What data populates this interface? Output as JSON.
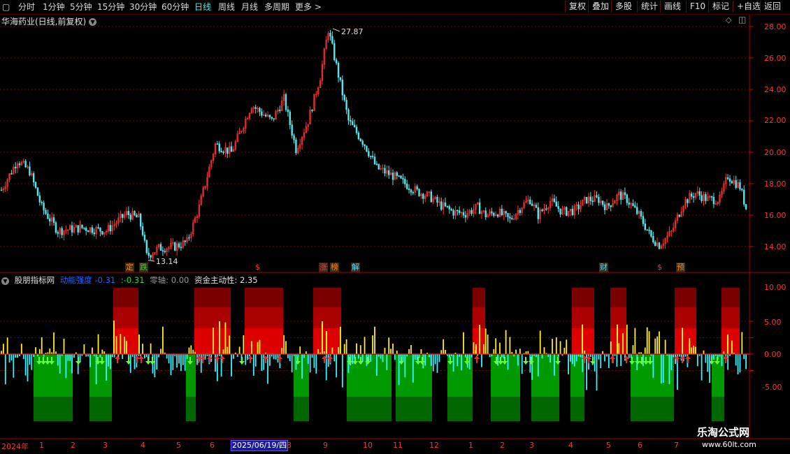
{
  "toolbar": {
    "periods": [
      "分时",
      "1分钟",
      "5分钟",
      "15分钟",
      "30分钟",
      "60分钟",
      "日线",
      "周线",
      "月线",
      "多周期",
      "更多 >"
    ],
    "active_period": "日线",
    "buttons": [
      "复权",
      "叠加",
      "多股",
      "统计",
      "画线",
      "F10",
      "标记",
      "+自选",
      "返回"
    ]
  },
  "stock_title": "华海药业(日线,前复权)",
  "price_axis": [
    "28.00",
    "26.00",
    "24.00",
    "22.00",
    "20.00",
    "18.00",
    "16.00",
    "14.00"
  ],
  "high_label": "27.87",
  "low_label": "13.14",
  "event_tags": [
    {
      "text": "定",
      "color": "#ff8800"
    },
    {
      "text": "跌",
      "color": "#33dd33"
    },
    {
      "text": "$",
      "color": "#ff3333"
    },
    {
      "text": "涨",
      "color": "#ff3333"
    },
    {
      "text": "榜",
      "color": "#ff8800"
    },
    {
      "text": "解",
      "color": "#55ddff"
    },
    {
      "text": "财",
      "color": "#55ddff"
    },
    {
      "text": "$",
      "color": "#ff3333"
    },
    {
      "text": "预",
      "color": "#ff8800"
    }
  ],
  "indicator": {
    "name": "股朋指标网",
    "field1_label": "动能强度",
    "field1_value": "-0.31",
    "field2_value": ":-0.31",
    "field3_label": "零轴:",
    "field3_value": "0.00",
    "field4_label": "资金主动性:",
    "field4_value": "2.35"
  },
  "indicator_axis": [
    "10.00",
    "5.00",
    "0.00",
    "-5.00"
  ],
  "date_axis": {
    "start": "2024年",
    "months": [
      "1",
      "2",
      "3",
      "4",
      "5",
      "6",
      "8",
      "9",
      "10",
      "11",
      "12",
      "1",
      "2",
      "3",
      "4",
      "5",
      "6",
      "7"
    ],
    "cursor": "2025/06/19/四"
  },
  "watermark": {
    "line1": "乐淘公式网",
    "line2": "www.60lt.com"
  },
  "colors": {
    "up": "#ff3333",
    "down": "#55e8ee",
    "bar_pos": "#ffee22",
    "bar_neg": "#33f5ff",
    "zone_red": "#cc0000",
    "zone_green": "#008800",
    "grid": "#7a0000"
  }
}
